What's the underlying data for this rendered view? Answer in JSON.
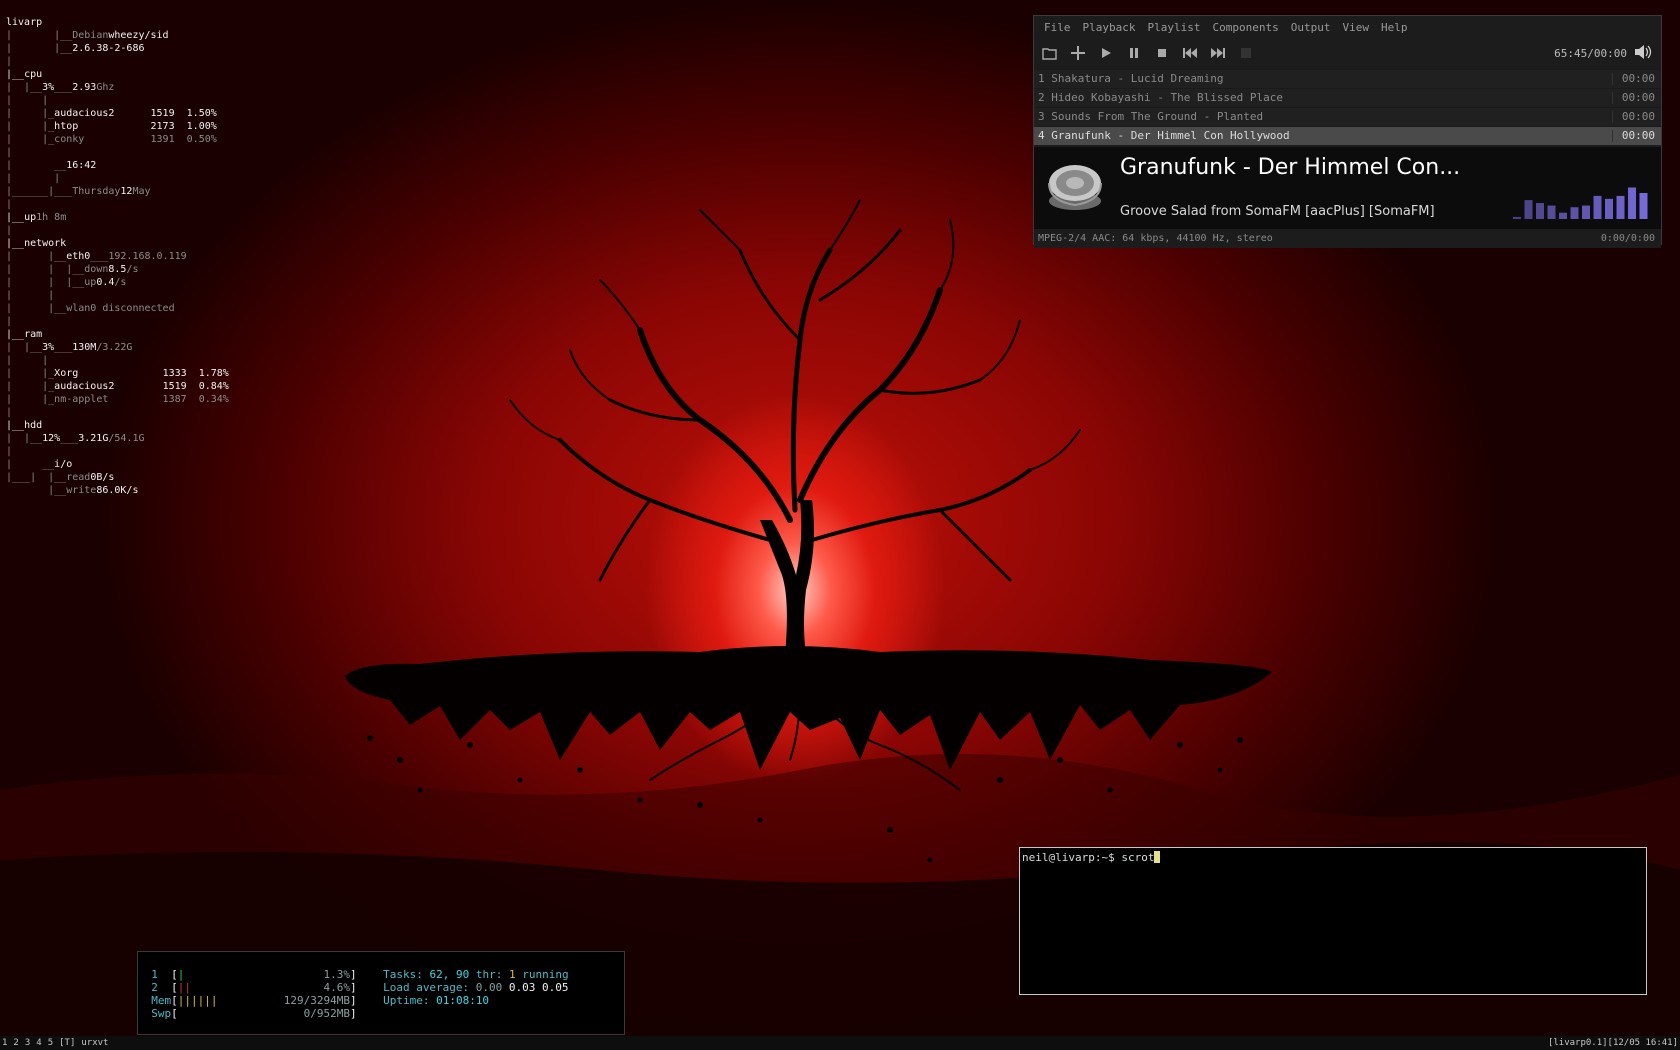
{
  "conky": {
    "host": "livarp",
    "distro_label": "Debian",
    "distro": "wheezy/sid",
    "kernel": "2.6.38-2-686",
    "cpu_label": "cpu",
    "cpu_pct": "3%",
    "cpu_freq": "2.93",
    "cpu_freq_unit": "Ghz",
    "cpu_procs": [
      {
        "name": "audacious2",
        "pid": "1519",
        "pct": "1.50%"
      },
      {
        "name": "htop",
        "pid": "2173",
        "pct": "1.00%"
      },
      {
        "name": "conky",
        "pid": "1391",
        "pct": "0.50%"
      }
    ],
    "time": "16:42",
    "day": "Thursday",
    "date_num": "12",
    "month": "May",
    "up_label": "up",
    "uptime": "1h 8m",
    "network_label": "network",
    "eth": "eth0",
    "ip": "192.168.0.119",
    "down_label": "down",
    "down": "8.5",
    "up_speed_label": "up",
    "up_speed": "0.4",
    "rate_unit": "/s",
    "wlan": "wlan0 disconnected",
    "ram_label": "ram",
    "ram_pct": "3%",
    "ram_used": "130M",
    "ram_total": "/3.22G",
    "ram_procs": [
      {
        "name": "Xorg",
        "pid": "1333",
        "pct": "1.78%"
      },
      {
        "name": "audacious2",
        "pid": "1519",
        "pct": "0.84%"
      },
      {
        "name": "nm-applet",
        "pid": "1387",
        "pct": "0.34%"
      }
    ],
    "hdd_label": "hdd",
    "hdd_pct": "12%",
    "hdd_used": "3.21G",
    "hdd_total": "/54.1G",
    "io_label": "i/o",
    "read_label": "read",
    "read": "0B/s",
    "write_label": "write",
    "write": "86.0K/s"
  },
  "audacious": {
    "menu": [
      "File",
      "Playback",
      "Playlist",
      "Components",
      "Output",
      "View",
      "Help"
    ],
    "time": "65:45/00:00",
    "playlist": [
      {
        "num": "1",
        "title": "Shakatura - Lucid Dreaming",
        "len": "00:00"
      },
      {
        "num": "2",
        "title": "Hideo Kobayashi - The Blissed Place",
        "len": "00:00"
      },
      {
        "num": "3",
        "title": "Sounds From The Ground - Planted",
        "len": "00:00"
      },
      {
        "num": "4",
        "title": "Granufunk - Der Himmel Con Hollywood",
        "len": "00:00"
      }
    ],
    "now_title": "Granufunk - Der Himmel Con...",
    "now_stream": "Groove Salad from SomaFM [aacPlus] [SomaFM]",
    "viz_levels": [
      0.05,
      0.45,
      0.38,
      0.32,
      0.15,
      0.28,
      0.32,
      0.55,
      0.48,
      0.55,
      0.75,
      0.62
    ],
    "viz_color": "#7a6ee0",
    "status_left": "MPEG-2/4 AAC: 64 kbps, 44100 Hz, stereo",
    "status_right": "0:00/0:00"
  },
  "terminal": {
    "prompt": "neil@livarp:~$",
    "command": "scrot"
  },
  "htop": {
    "cpu1_label": "1",
    "cpu1_bar": "|",
    "cpu1_val": "1.3%",
    "cpu2_label": "2",
    "cpu2_bar": "||",
    "cpu2_val": "4.6%",
    "mem_label": "Mem",
    "mem_bar": "||||||",
    "mem_val": "129/3294MB",
    "swp_label": "Swp",
    "swp_val": "0/952MB",
    "tasks_label": "Tasks:",
    "tasks": "62,",
    "thr": "90",
    "thr_label": "thr:",
    "running": "1",
    "running_label": "running",
    "load_label": "Load average:",
    "load1": "0.00",
    "load2": "0.03",
    "load3": "0.05",
    "uptime_label": "Uptime:",
    "uptime": "01:08:10"
  },
  "taskbar": {
    "workspaces": [
      "1",
      "2",
      "3",
      "4",
      "5"
    ],
    "layout": "[T]",
    "window": "urxvt",
    "status": "[livarp0.1][12/05 16:41]"
  }
}
